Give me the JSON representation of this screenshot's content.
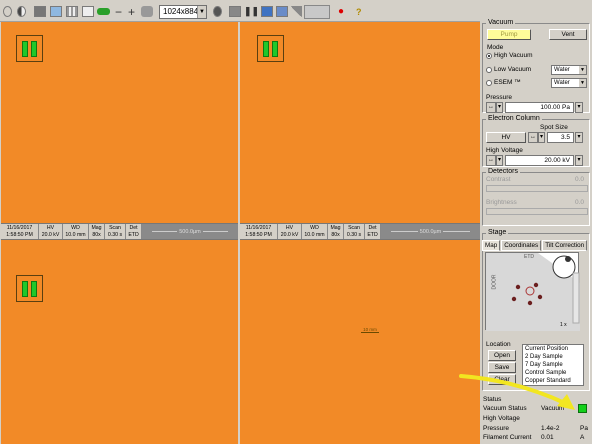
{
  "toolbar": {
    "resolution": "1024x884",
    "help_icon": "?"
  },
  "databar": {
    "left": {
      "date": "11/16/2017",
      "time": "1:58:50 PM",
      "hv_label": "HV",
      "hv": "20.0 kV",
      "wd_label": "WD",
      "wd": "10.0 mm",
      "mag_label": "Mag",
      "mag": "80x",
      "scan_label": "Scan",
      "scan": "0.30 s",
      "det_label": "Det",
      "det": "ETD",
      "scale": "500.0µm"
    },
    "right": {
      "date": "11/16/2017",
      "time": "1:58:50 PM",
      "hv_label": "HV",
      "hv": "20.0 kV",
      "wd_label": "WD",
      "wd": "10.0 mm",
      "mag_label": "Mag",
      "mag": "80x",
      "scan_label": "Scan",
      "scan": "0.30 s",
      "det_label": "Det",
      "det": "ETD",
      "scale": "500.0µm"
    }
  },
  "quad4_scale": "10 mm",
  "vacuum": {
    "title": "Vacuum",
    "pump": "Pump",
    "vent": "Vent",
    "mode_title": "Mode",
    "high_vacuum": "High Vacuum",
    "low_vacuum": "Low Vacuum",
    "esem": "ESEM ™",
    "low_vacuum_gas": "Water",
    "esem_gas": "Water",
    "pressure_label": "Pressure",
    "pressure": "100.00 Pa"
  },
  "electron_column": {
    "title": "Electron Column",
    "spot_label": "Spot Size",
    "hv_button": "HV",
    "spot": "3.5",
    "hv_label": "High Voltage",
    "hv": "20.00 kV"
  },
  "detectors": {
    "title": "Detectors",
    "contrast_label": "Contrast",
    "contrast": "0.0",
    "brightness_label": "Brightness",
    "brightness": "0.0"
  },
  "stage": {
    "title": "Stage",
    "tabs": [
      "Map",
      "Coordinates",
      "Tilt Correction"
    ],
    "etd_label": "ETD",
    "door_label": "DOOR",
    "zoom": "1 x",
    "location_label": "Location",
    "open": "Open",
    "save": "Save",
    "clear": "Clear",
    "locations": [
      "Current Position",
      "2 Day Sample",
      "7 Day Sample",
      "Control Sample",
      "Copper Standard"
    ]
  },
  "status": {
    "title": "Status",
    "vacuum_label": "Vacuum Status",
    "vacuum_value": "Vacuum",
    "hv_label": "High Voltage",
    "pressure_label": "Pressure",
    "pressure_value": "1.4e-2",
    "pressure_unit": "Pa",
    "filament_label": "Filament Current",
    "filament_value": "0.01",
    "filament_unit": "A"
  },
  "colors": {
    "image_bg": "#f28a27",
    "led": "#13d01a",
    "arrow": "#f2e620"
  }
}
